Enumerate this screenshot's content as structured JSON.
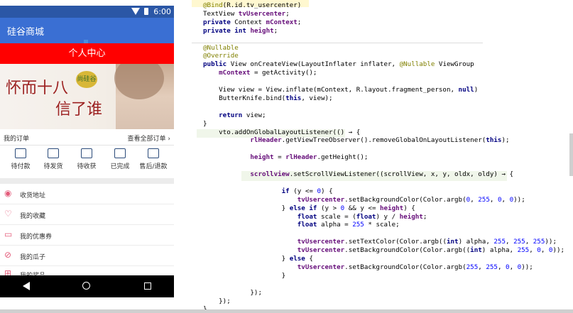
{
  "phone": {
    "time": "6:00",
    "app_title": "硅谷商城",
    "header": "个人中心",
    "banner": {
      "logo_text": "尚硅谷",
      "calligraphy_a": "怀而十八",
      "calligraphy_b": "信了谁"
    },
    "orders": {
      "label": "我的订单",
      "view_all": "查看全部订单 ›",
      "tabs": [
        "待付款",
        "待发货",
        "待收获",
        "已完成",
        "售后/退款"
      ]
    },
    "menu": [
      {
        "label": "收货地址",
        "icon": "location-icon"
      },
      {
        "label": "我的收藏",
        "icon": "heart-icon"
      },
      {
        "label": "我的优惠券",
        "icon": "coupon-icon"
      },
      {
        "label": "我的瓜子",
        "icon": "seed-icon"
      },
      {
        "label": "我的奖品",
        "icon": "gift-icon"
      }
    ]
  },
  "code": {
    "lines": [
      "@Bind(R.id.tv_usercenter)",
      "TextView tvUsercenter;",
      "private Context mContext;",
      "private int height;",
      "",
      "@Nullable",
      "@Override",
      "public View onCreateView(LayoutInflater inflater, @Nullable ViewGroup",
      "    mContext = getActivity();",
      "",
      "    View view = View.inflate(mContext, R.layout.fragment_person, null)",
      "    ButterKnife.bind(this, view);",
      "",
      "    return view;",
      "}",
      "    vto.addOnGlobalLayoutListener(() → {",
      "            rlHeader.getViewTreeObserver().removeGlobalOnLayoutListener(this);",
      "",
      "            height = rlHeader.getHeight();",
      "",
      "            scrollview.setScrollViewListener((scrollView, x, y, oldx, oldy) → {",
      "",
      "                    if (y <= 0) {",
      "                        tvUsercenter.setBackgroundColor(Color.argb(0, 255, 0, 0));",
      "                    } else if (y > 0 && y <= height) {",
      "                        float scale = (float) y / height;",
      "                        float alpha = 255 * scale;",
      "",
      "                        tvUsercenter.setTextColor(Color.argb((int) alpha, 255, 255, 255));",
      "                        tvUsercenter.setBackgroundColor(Color.argb((int) alpha, 255, 0, 0));",
      "                    } else {",
      "                        tvUsercenter.setBackgroundColor(Color.argb(255, 255, 0, 0));",
      "                    }",
      "",
      "            });",
      "    });",
      "}"
    ]
  },
  "colors": {
    "status_bar": "#2b57a6",
    "app_bar": "#3a6fd3",
    "header_red": "#ff0000",
    "keyword": "#000080",
    "annotation": "#808000",
    "field": "#660e7a"
  }
}
